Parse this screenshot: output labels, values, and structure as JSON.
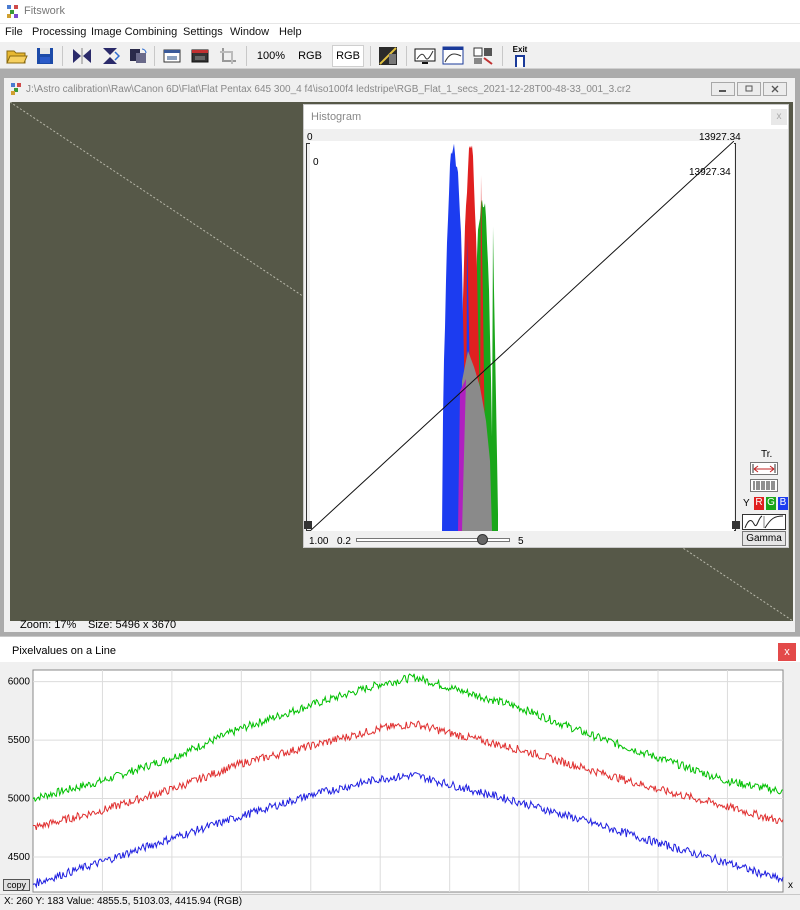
{
  "app": {
    "title": "Fitswork"
  },
  "menu": [
    "File",
    "Processing",
    "Image Combining",
    "Settings",
    "Window",
    "Help"
  ],
  "toolbar": {
    "zoom_label": "100%",
    "rgb_label_1": "RGB",
    "rgb_label_2": "RGB",
    "exit_label": "Exit"
  },
  "image_window": {
    "title": "J:\\Astro calibration\\Raw\\Canon 6D\\Flat\\Flat Pentax 645 300_4 f4\\iso100f4 ledstripe\\RGB_Flat_1_secs_2021-12-28T00-48-33_001_3.cr2",
    "zoom_text": "Zoom: 17%",
    "size_text": "Size: 5496 x 3670"
  },
  "histogram": {
    "title": "Histogram",
    "close": "x",
    "min_label": "0",
    "max_label": "13927.34",
    "inner_min_label": "0",
    "inner_max_label": "13927.34",
    "gamma_value": "1.00",
    "slider_min": "0.2",
    "slider_max": "5",
    "slider_value": 0.82,
    "tr_label": "Tr.",
    "y_label": "Y",
    "r_label": "R",
    "g_label": "G",
    "b_label": "B",
    "gamma_button": "Gamma",
    "colors": {
      "red": "#e02020",
      "green": "#1aa61a",
      "blue": "#1c3cf0",
      "overlap": "#8a8a8a",
      "magenta": "#b020c0"
    }
  },
  "line_panel": {
    "title": "Pixelvalues on a Line",
    "close": "x",
    "copy_label": "copy"
  },
  "chart_data": {
    "type": "line",
    "title": "",
    "xlabel": "x",
    "ylabel": "",
    "xlim": [
      0,
      5400
    ],
    "ylim": [
      4200,
      6100
    ],
    "xticks": [
      500,
      1000,
      1500,
      2000,
      2500,
      3000,
      3500,
      4000,
      4500,
      5000
    ],
    "yticks": [
      4500,
      5000,
      5500,
      6000
    ],
    "grid": true,
    "series": [
      {
        "name": "G",
        "color": "#00c000",
        "points": [
          [
            0,
            5000
          ],
          [
            500,
            5150
          ],
          [
            1000,
            5350
          ],
          [
            1500,
            5600
          ],
          [
            2000,
            5800
          ],
          [
            2500,
            5980
          ],
          [
            2750,
            6040
          ],
          [
            3000,
            5950
          ],
          [
            3500,
            5780
          ],
          [
            4000,
            5550
          ],
          [
            4500,
            5350
          ],
          [
            5000,
            5150
          ],
          [
            5400,
            5060
          ]
        ]
      },
      {
        "name": "R",
        "color": "#e03030",
        "points": [
          [
            0,
            4750
          ],
          [
            500,
            4900
          ],
          [
            1000,
            5080
          ],
          [
            1500,
            5300
          ],
          [
            2000,
            5450
          ],
          [
            2500,
            5600
          ],
          [
            2750,
            5640
          ],
          [
            3000,
            5560
          ],
          [
            3500,
            5420
          ],
          [
            4000,
            5250
          ],
          [
            4500,
            5080
          ],
          [
            5000,
            4930
          ],
          [
            5400,
            4800
          ]
        ]
      },
      {
        "name": "B",
        "color": "#2020e0",
        "points": [
          [
            0,
            4270
          ],
          [
            500,
            4460
          ],
          [
            1000,
            4660
          ],
          [
            1500,
            4850
          ],
          [
            2000,
            5030
          ],
          [
            2500,
            5170
          ],
          [
            2750,
            5200
          ],
          [
            3000,
            5120
          ],
          [
            3500,
            4970
          ],
          [
            4000,
            4800
          ],
          [
            4500,
            4620
          ],
          [
            5000,
            4450
          ],
          [
            5400,
            4300
          ]
        ]
      }
    ]
  },
  "status": {
    "text": "X: 260  Y: 183  Value: 4855.5, 5103.03, 4415.94 (RGB)"
  }
}
